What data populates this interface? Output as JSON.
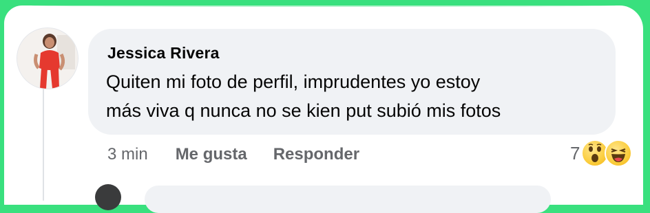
{
  "comment": {
    "author": "Jessica Rivera",
    "text": "Quiten mi foto de perfil, imprudentes yo estoy\nmás viva q nunca no se kien put subió mis fotos",
    "timestamp": "3 min",
    "like_label": "Me gusta",
    "reply_label": "Responder",
    "reaction_count": "7",
    "reactions": [
      "wow-emoji-icon",
      "haha-emoji-icon"
    ]
  },
  "colors": {
    "frame_border": "#39e07e",
    "bubble": "#f0f2f5",
    "secondary_text": "#65676b",
    "primary_text": "#050505",
    "reaction_yellow": "#fbcd3c"
  }
}
